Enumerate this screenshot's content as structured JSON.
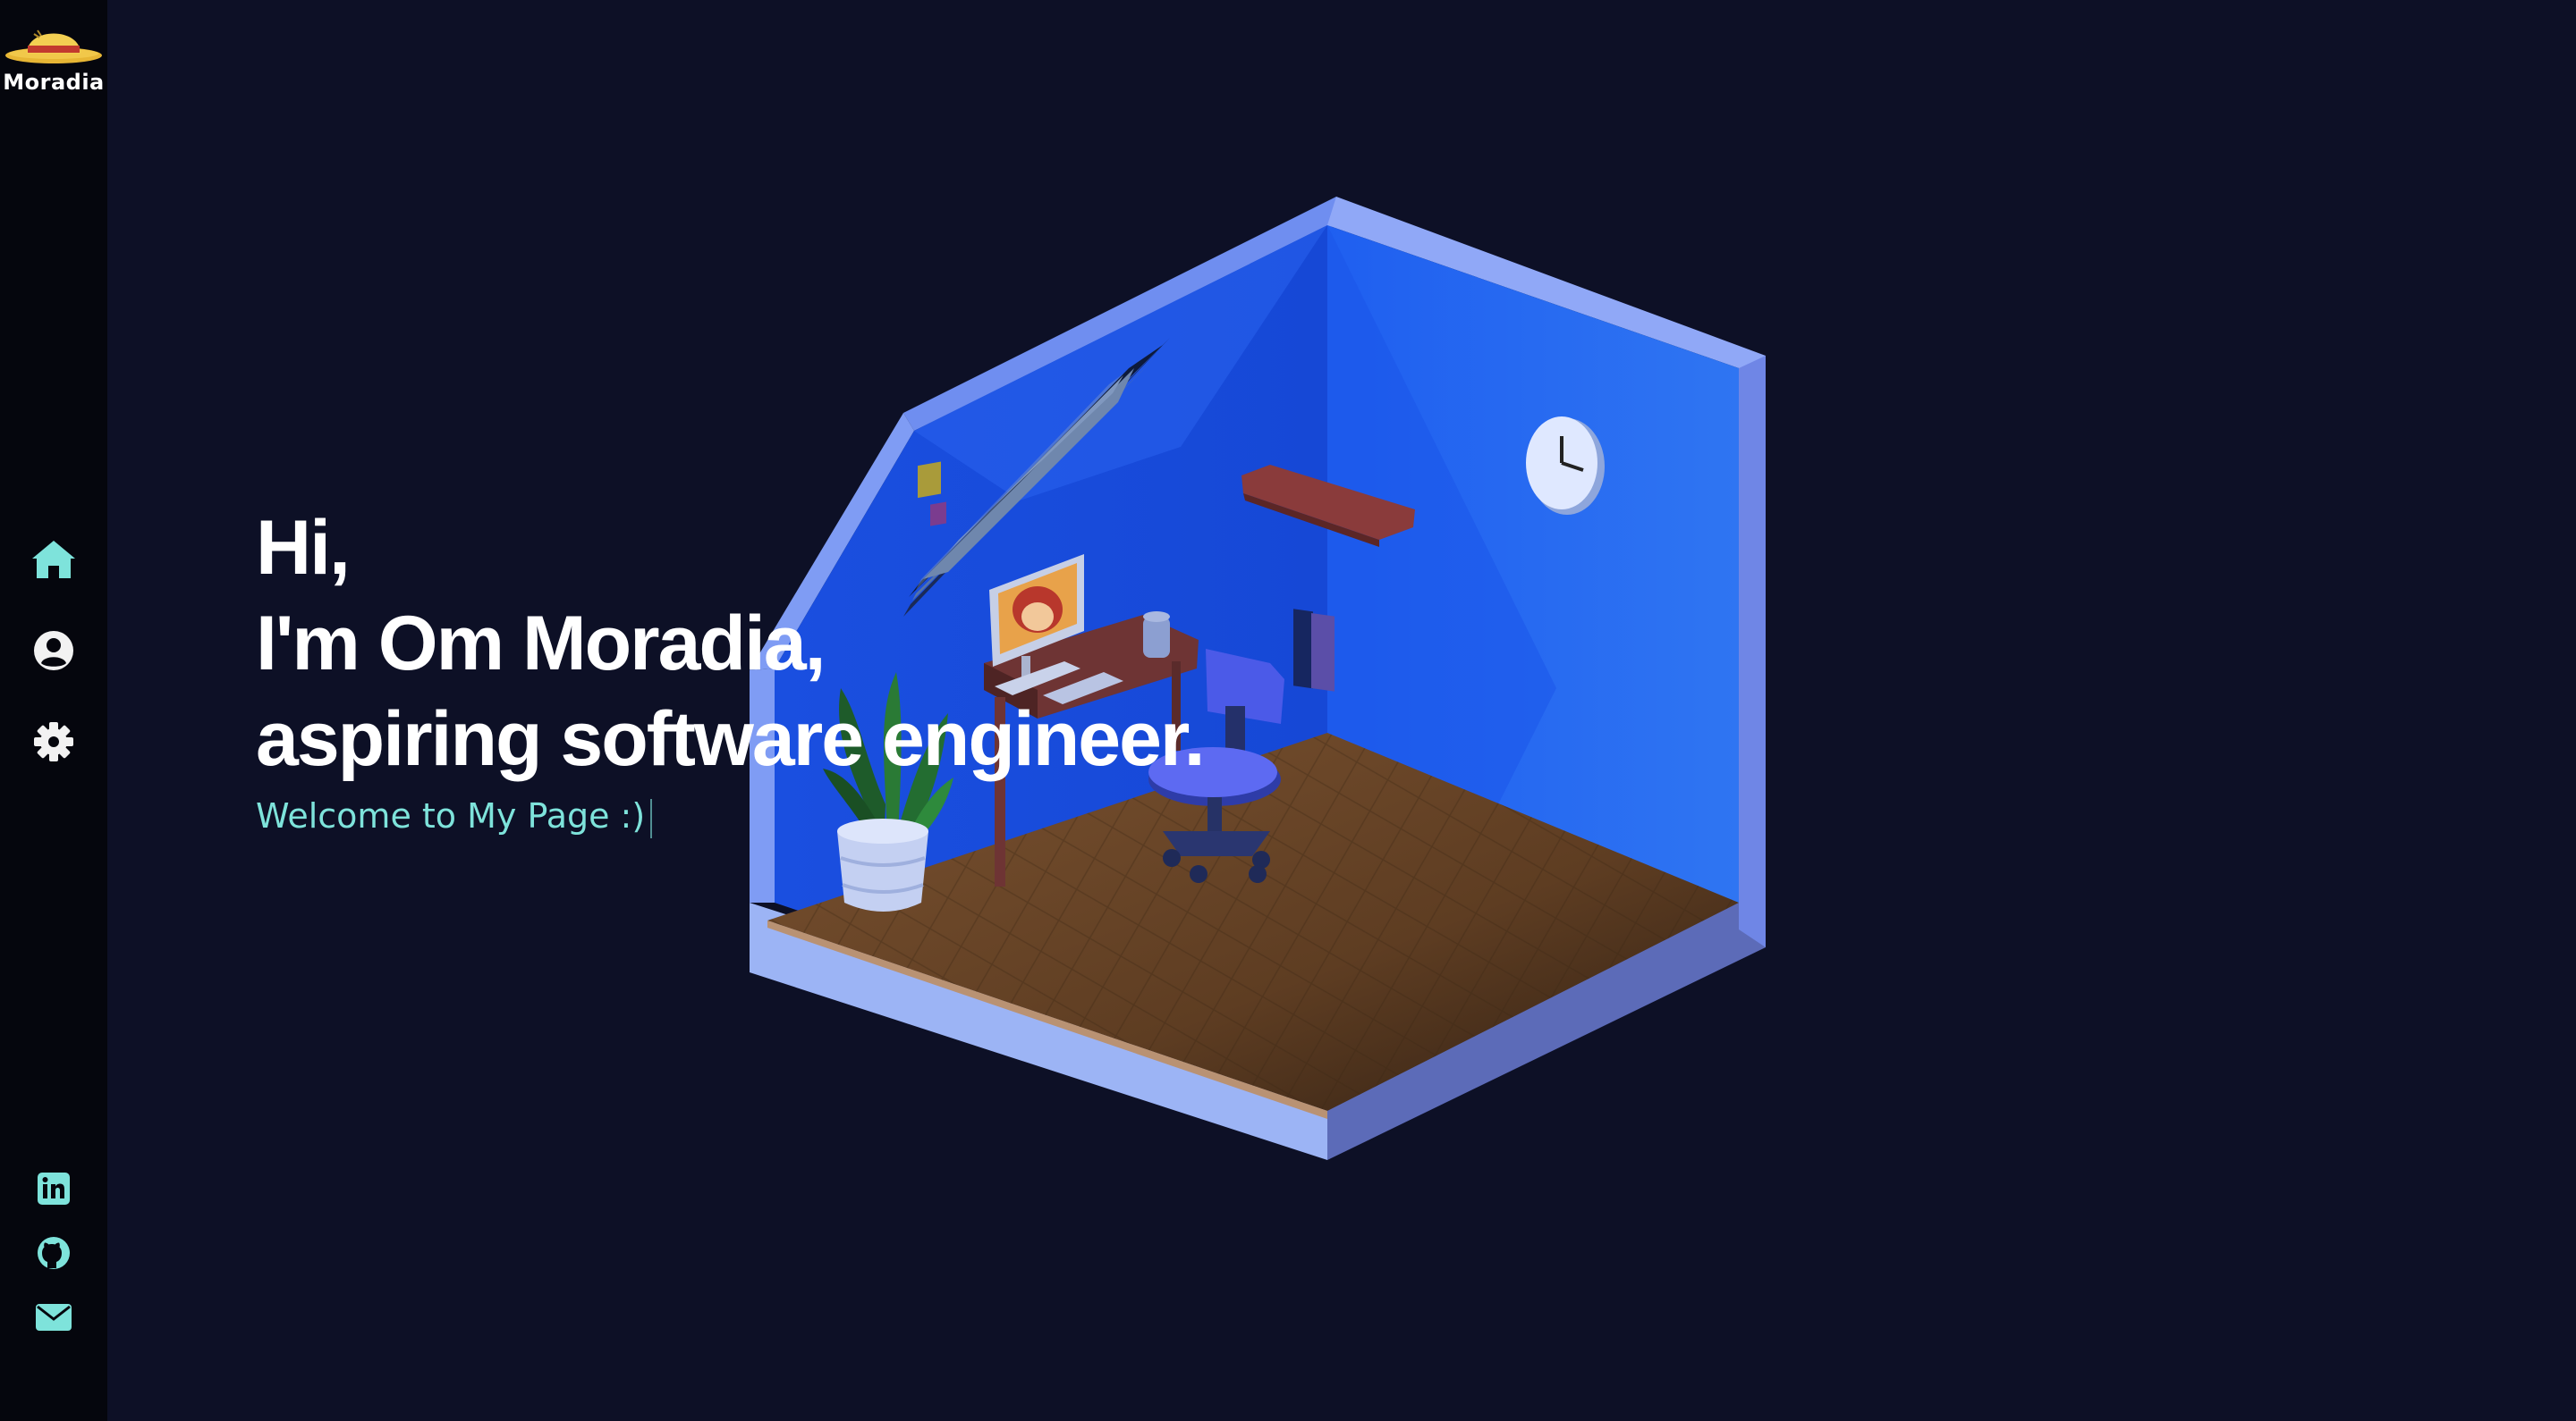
{
  "brand": {
    "logo_text": "Moradia"
  },
  "sidebar": {
    "nav": [
      {
        "name": "home",
        "icon": "home-icon",
        "active": true
      },
      {
        "name": "about",
        "icon": "user-circle-icon",
        "active": false
      },
      {
        "name": "skills",
        "icon": "gear-icon",
        "active": false
      }
    ],
    "social": [
      {
        "name": "linkedin",
        "icon": "linkedin-icon"
      },
      {
        "name": "github",
        "icon": "github-icon"
      },
      {
        "name": "email",
        "icon": "envelope-icon"
      }
    ]
  },
  "hero": {
    "line1": "Hi,",
    "line2": "I'm Om Moradia,",
    "line3": "aspiring software engineer.",
    "subtitle": "Welcome to My Page :)"
  },
  "colors": {
    "background": "#0d1026",
    "sidebar": "#05060d",
    "accent": "#7ee3db",
    "heading": "#ffffff",
    "room_wall": "#2a6ff0",
    "room_floor": "#6b4526"
  }
}
